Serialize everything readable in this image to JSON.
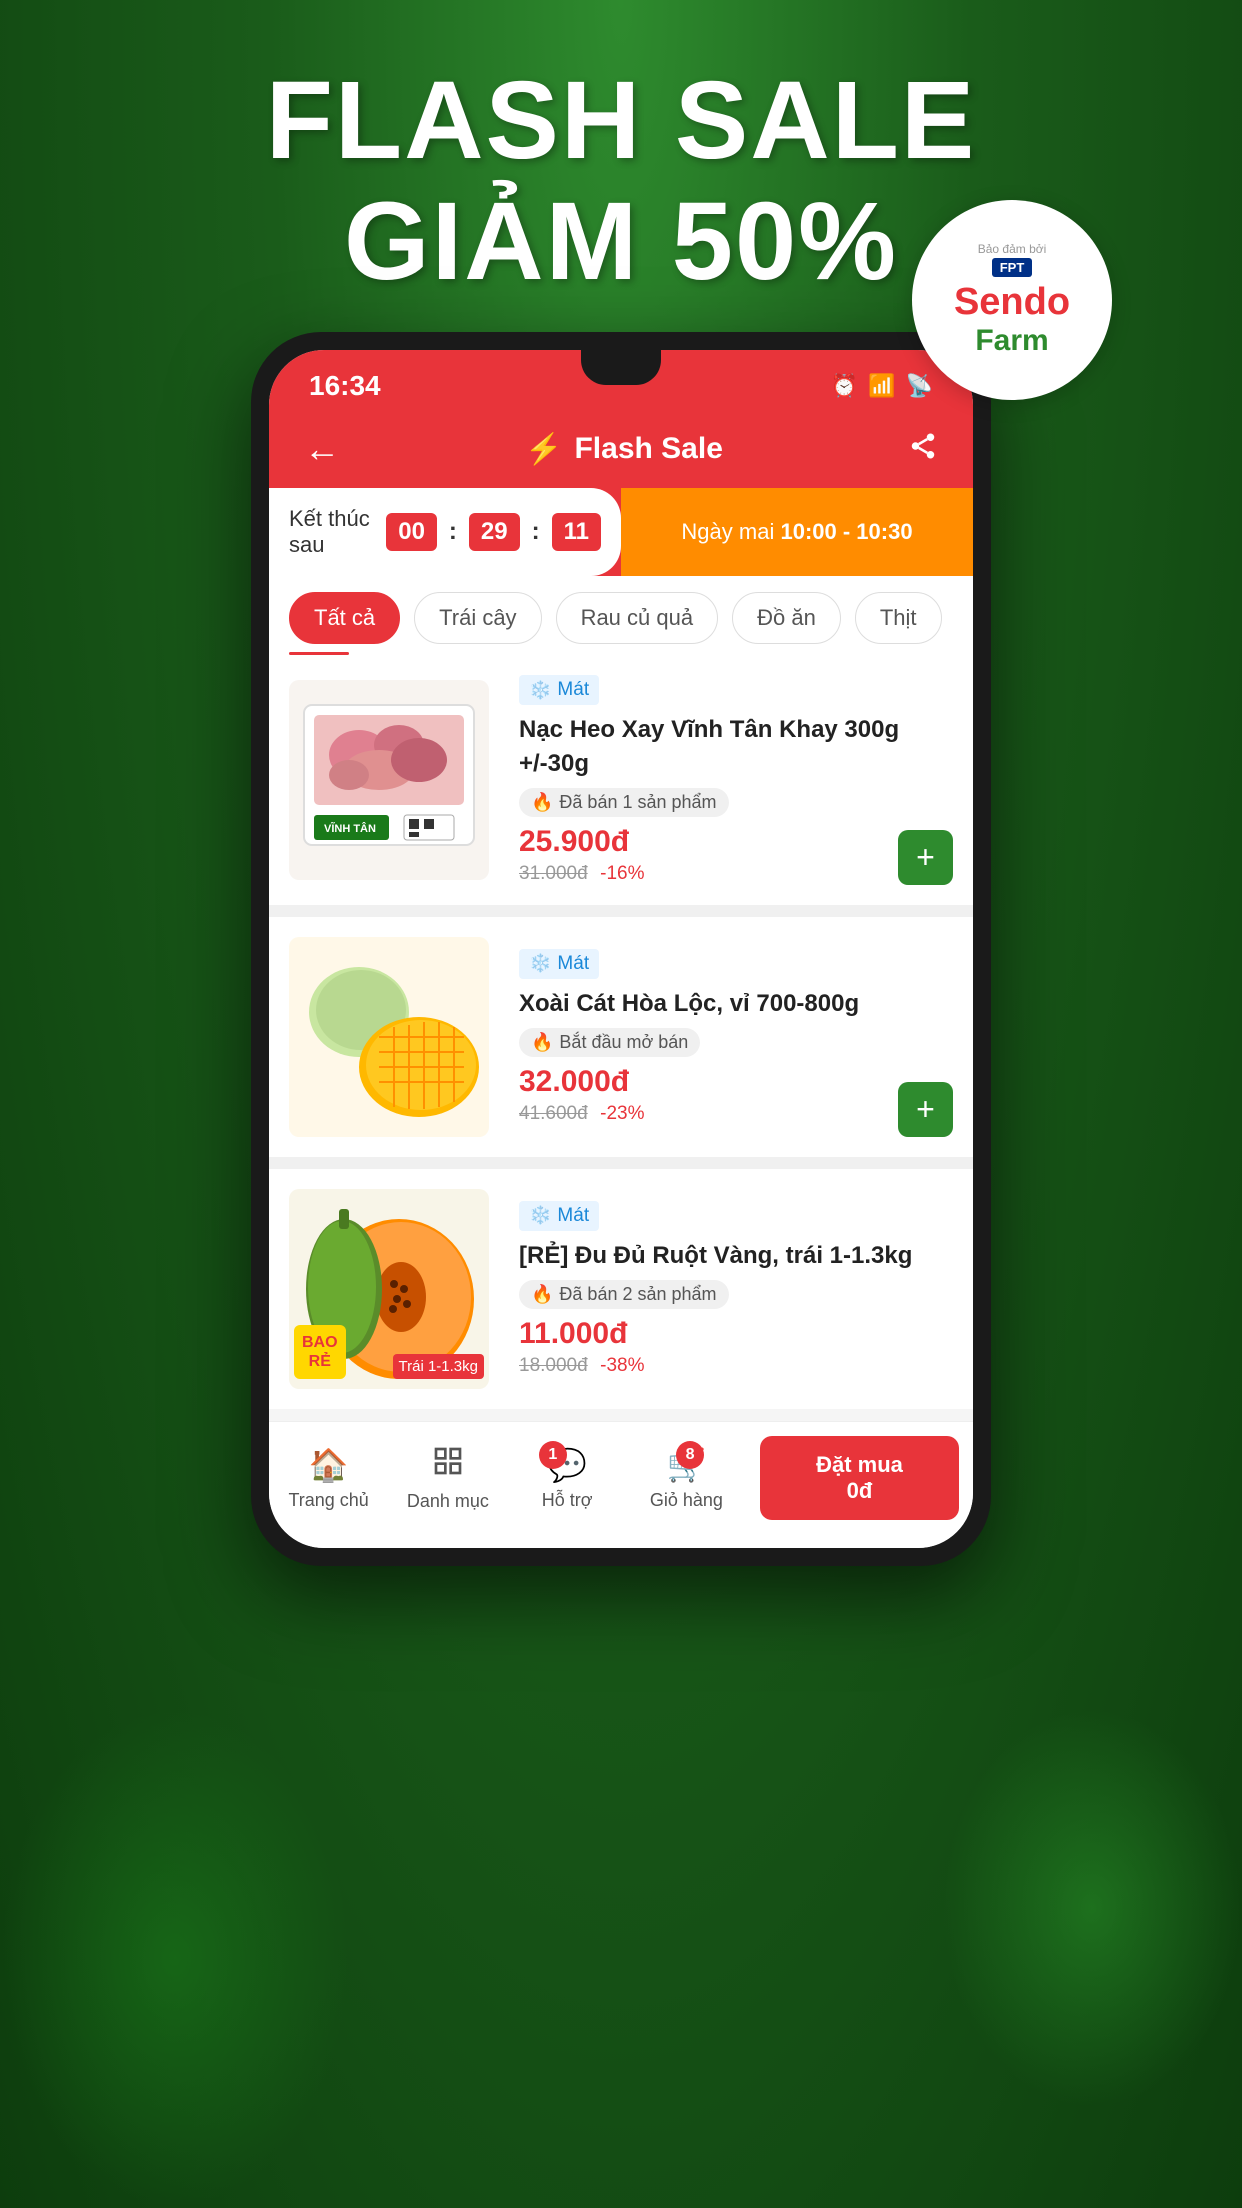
{
  "background": {
    "color_top": "#2e8b2e",
    "color_bottom": "#0d3d0d"
  },
  "promo": {
    "line1": "FLASH SALE",
    "line2": "GIẢM 50%"
  },
  "sendo_badge": {
    "supported_by": "Bảo đảm bởi",
    "brand": "FPT",
    "name1": "Sendo",
    "name2": "Farm"
  },
  "status_bar": {
    "time": "16:34",
    "icons": [
      "⏰",
      "📶",
      "📡"
    ]
  },
  "header": {
    "back_label": "←",
    "flash_icon": "⚡",
    "title": "Flash Sale",
    "share_icon": "share"
  },
  "timer": {
    "label": "Kết thúc sau",
    "hours": "00",
    "minutes": "29",
    "seconds": "11",
    "next_label": "Ngày mai",
    "next_time": "10:00 - 10:30"
  },
  "categories": [
    {
      "id": "all",
      "label": "Tất cả",
      "active": true
    },
    {
      "id": "fruit",
      "label": "Trái cây",
      "active": false
    },
    {
      "id": "veg",
      "label": "Rau củ quả",
      "active": false
    },
    {
      "id": "food",
      "label": "Đồ ăn",
      "active": false
    },
    {
      "id": "meat",
      "label": "Thịt",
      "active": false
    }
  ],
  "products": [
    {
      "badge": "Mát",
      "name": "Nạc Heo Xay Vĩnh Tân Khay 300g +/-30g",
      "sold": "Đã bán 1 sản phẩm",
      "price": "25.900đ",
      "original_price": "31.000đ",
      "discount": "-16%",
      "add_label": "+"
    },
    {
      "badge": "Mát",
      "name": "Xoài Cát Hòa Lộc,  vỉ 700-800g",
      "sold": "Bắt đầu mở bán",
      "price": "32.000đ",
      "original_price": "41.600đ",
      "discount": "-23%",
      "add_label": "+"
    },
    {
      "badge": "Mát",
      "name": "[RẺ] Đu Đủ Ruột Vàng, trái 1-1.3kg",
      "sold": "Đã bán 2 sản phẩm",
      "price": "11.000đ",
      "original_price": "18.000đ",
      "discount": "-38%",
      "bao_re": "BAO\nRẺ",
      "trai_label": "Trái 1-1.3kg",
      "add_label": "+"
    }
  ],
  "bottom_nav": [
    {
      "id": "home",
      "icon": "🏠",
      "label": "Trang chủ",
      "badge": null
    },
    {
      "id": "menu",
      "icon": "☰",
      "label": "Danh mục",
      "badge": null
    },
    {
      "id": "support",
      "icon": "💬",
      "label": "Hỗ trợ",
      "badge": "1"
    },
    {
      "id": "cart",
      "icon": "🛒",
      "label": "Giỏ hàng",
      "badge": "8"
    }
  ],
  "order_button": {
    "label": "Đặt mua",
    "price": "0đ"
  }
}
